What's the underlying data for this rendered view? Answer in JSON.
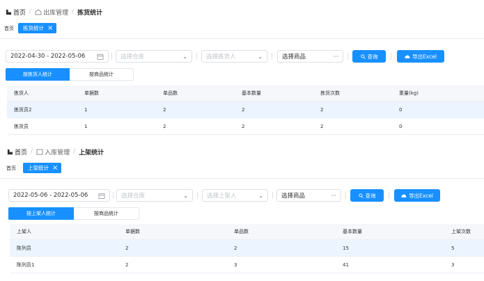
{
  "panel1": {
    "breadcrumb": {
      "home": "首页",
      "parent": "出库管理",
      "current": "拣货统计"
    },
    "tabs": {
      "home": "首页",
      "active": "拣货统计"
    },
    "filters": {
      "date_range": "2022-04-30 - 2022-05-06",
      "warehouse_placeholder": "选择仓库",
      "person_placeholder": "选择拣货人",
      "goods_placeholder": "选择商品",
      "goods_suffix": "···",
      "query": "查询",
      "export": "导出Excel"
    },
    "seg": {
      "on": "按拣货人统计",
      "off": "按商品统计"
    },
    "table": {
      "headers": [
        "拣货人",
        "单据数",
        "单品数",
        "基本数量",
        "拣货次数",
        "重量(kg)"
      ],
      "rows": [
        [
          "拣货员2",
          "1",
          "2",
          "2",
          "2",
          "0"
        ],
        [
          "拣货员",
          "1",
          "2",
          "2",
          "2",
          "0"
        ]
      ]
    }
  },
  "panel2": {
    "breadcrumb": {
      "home": "首页",
      "parent": "入库管理",
      "current": "上架统计"
    },
    "tabs": {
      "home": "首页",
      "active": "上架统计"
    },
    "filters": {
      "date_range": "2022-05-06 - 2022-05-06",
      "warehouse_placeholder": "选择仓库",
      "person_placeholder": "选择上架人",
      "goods_placeholder": "选择商品",
      "goods_suffix": "···",
      "query": "查询",
      "export": "导出Excel"
    },
    "seg": {
      "on": "按上架人统计",
      "off": "按商品统计"
    },
    "table": {
      "headers": [
        "上架人",
        "单据数",
        "单品数",
        "基本数量",
        "上架次数"
      ],
      "rows": [
        [
          "陈列员",
          "2",
          "2",
          "15",
          "5"
        ],
        [
          "陈列员1",
          "2",
          "3",
          "41",
          "3"
        ]
      ]
    }
  },
  "colors": {
    "primary": "#1890ff",
    "row_highlight": "#ecf5ff",
    "header_bg": "#f5f7fa"
  }
}
